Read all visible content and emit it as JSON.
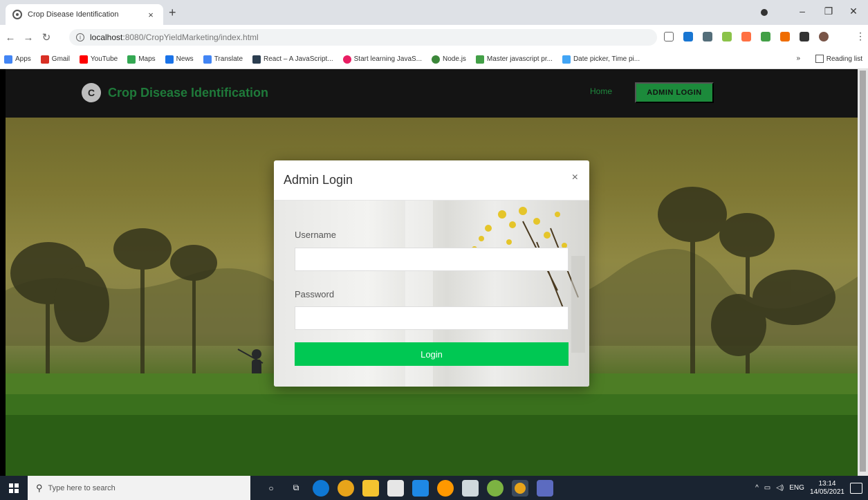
{
  "browser": {
    "tab_title": "Crop Disease Identification",
    "tab_close": "×",
    "new_tab": "+",
    "url_host": "localhost",
    "url_path": ":8080/CropYieldMarketing/index.html",
    "win_minimize": "–",
    "win_restore": "❐",
    "win_close": "✕",
    "menu": "⋮",
    "bookmarks": [
      {
        "label": "Apps",
        "color": "#4285f4"
      },
      {
        "label": "Gmail",
        "color": "#d93025"
      },
      {
        "label": "YouTube",
        "color": "#ff0000"
      },
      {
        "label": "Maps",
        "color": "#34a853"
      },
      {
        "label": "News",
        "color": "#1a73e8"
      },
      {
        "label": "Translate",
        "color": "#4285f4"
      },
      {
        "label": "React – A JavaScript...",
        "color": "#2c3e50"
      },
      {
        "label": "Start learning JavaS...",
        "color": "#e91e63"
      },
      {
        "label": "Node.js",
        "color": "#3c873a"
      },
      {
        "label": "Master javascript pr...",
        "color": "#43a047"
      },
      {
        "label": "Date picker, Time pi...",
        "color": "#42a5f5"
      }
    ],
    "bookmarks_more": "»",
    "reading_list": "Reading list"
  },
  "site": {
    "logo_letter": "C",
    "brand": "Crop Disease Identification",
    "nav_home": "Home",
    "nav_admin": "ADMIN LOGIN"
  },
  "modal": {
    "title": "Admin Login",
    "close": "×",
    "username_label": "Username",
    "username_value": "",
    "password_label": "Password",
    "password_value": "",
    "login_label": "Login"
  },
  "taskbar": {
    "search_placeholder": "Type here to search",
    "time": "13:14",
    "date": "14/05/2021",
    "lang": "ENG"
  },
  "colors": {
    "brand_green": "#1f7a3a",
    "login_green": "#00c853",
    "navbar": "#141414"
  }
}
